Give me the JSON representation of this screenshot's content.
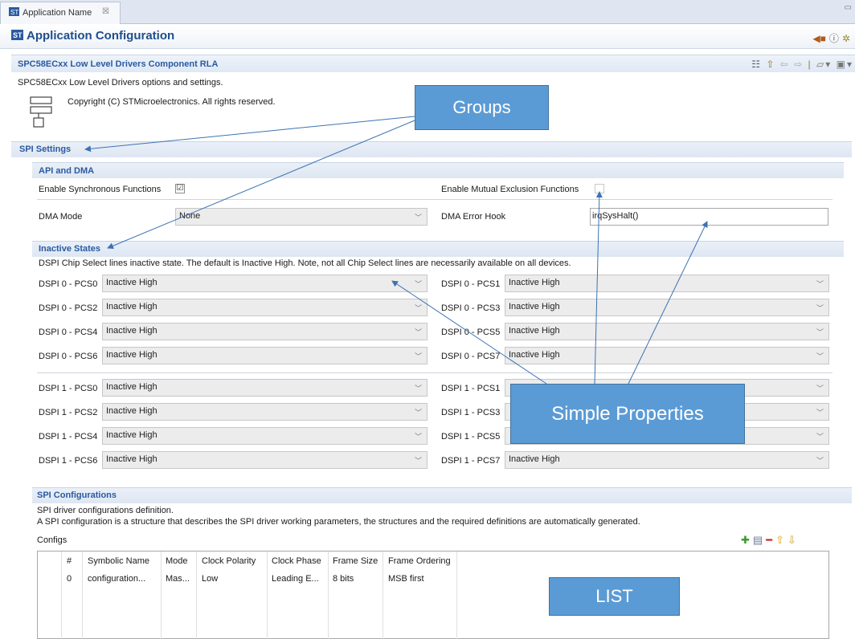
{
  "tab": {
    "label": "Application Name",
    "close": "☒"
  },
  "header": {
    "title": "Application Configuration"
  },
  "component": {
    "title": "SPC58ECxx Low Level Drivers Component RLA",
    "description": "SPC58ECxx Low Level Drivers options and settings.",
    "copyright": "Copyright (C) STMicroelectronics. All rights reserved."
  },
  "spi_settings": {
    "title": "SPI Settings",
    "api_dma": {
      "title": "API and DMA",
      "sync_label": "Enable Synchronous Functions",
      "sync_checked": "☑",
      "mutex_label": "Enable Mutual Exclusion Functions",
      "dma_mode_label": "DMA Mode",
      "dma_mode_value": "None",
      "dma_hook_label": "DMA Error Hook",
      "dma_hook_value": "irqSysHalt()"
    },
    "inactive": {
      "title": "Inactive States",
      "description": "DSPI Chip Select lines inactive state. The default is Inactive High. Note, not all Chip Select lines are necessarily available on all devices.",
      "rows": [
        {
          "l_label": "DSPI 0 - PCS0",
          "l_value": "Inactive High",
          "r_label": "DSPI 0 - PCS1",
          "r_value": "Inactive High"
        },
        {
          "l_label": "DSPI 0 - PCS2",
          "l_value": "Inactive High",
          "r_label": "DSPI 0 - PCS3",
          "r_value": "Inactive High"
        },
        {
          "l_label": "DSPI 0 - PCS4",
          "l_value": "Inactive High",
          "r_label": "DSPI 0 - PCS5",
          "r_value": "Inactive High"
        },
        {
          "l_label": "DSPI 0 - PCS6",
          "l_value": "Inactive High",
          "r_label": "DSPI 0 - PCS7",
          "r_value": "Inactive High"
        },
        {
          "l_label": "DSPI 1 - PCS0",
          "l_value": "Inactive High",
          "r_label": "DSPI 1 - PCS1",
          "r_value": ""
        },
        {
          "l_label": "DSPI 1 - PCS2",
          "l_value": "Inactive High",
          "r_label": "DSPI 1 - PCS3",
          "r_value": ""
        },
        {
          "l_label": "DSPI 1 - PCS4",
          "l_value": "Inactive High",
          "r_label": "DSPI 1 - PCS5",
          "r_value": ""
        },
        {
          "l_label": "DSPI 1 - PCS6",
          "l_value": "Inactive High",
          "r_label": "DSPI 1 - PCS7",
          "r_value": "Inactive High"
        }
      ]
    }
  },
  "spi_configs": {
    "title": "SPI Configurations",
    "desc1": "SPI driver configurations definition.",
    "desc2": "A SPI configuration is a structure that describes the SPI driver working parameters, the structures and the required definitions are automatically generated.",
    "configs_label": "Configs",
    "columns": [
      "#",
      "Symbolic Name",
      "Mode",
      "Clock Polarity",
      "Clock Phase",
      "Frame Size",
      "Frame Ordering"
    ],
    "row": [
      "0",
      "configuration...",
      "Mas...",
      "Low",
      "Leading E...",
      "8 bits",
      "MSB first"
    ]
  },
  "callouts": {
    "groups": "Groups",
    "simple": "Simple Properties",
    "list": "LIST"
  },
  "icons": {
    "tab": "st-logo-icon",
    "header": "st-logo-icon",
    "component": "component-tree-icon",
    "add": "add-icon",
    "copy": "copy-icon",
    "remove": "remove-icon",
    "up": "move-up-icon",
    "down": "move-down-icon"
  },
  "colors": {
    "accent": "#2a5aa0",
    "callout": "#5b9bd5"
  }
}
